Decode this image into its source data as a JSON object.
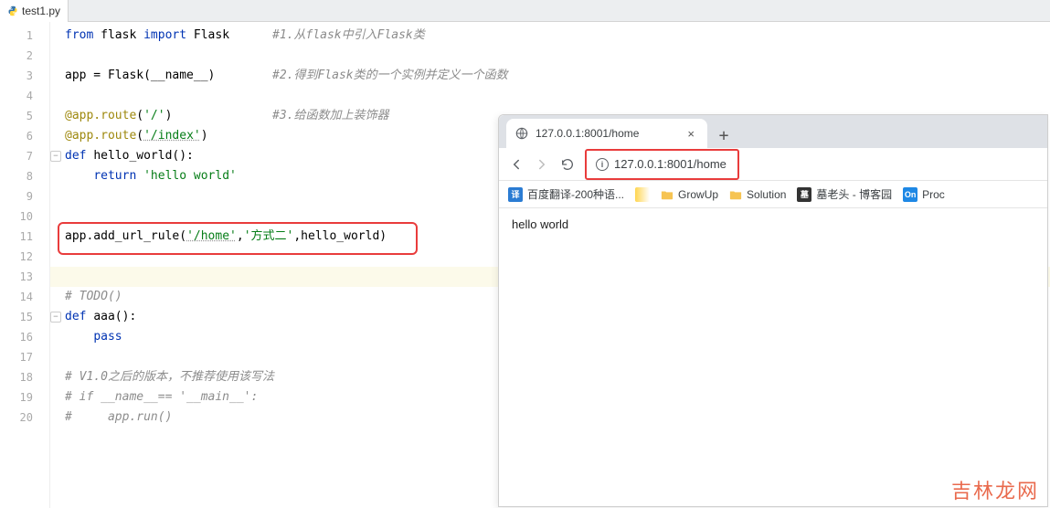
{
  "tab": {
    "filename": "test1.py"
  },
  "gutter": [
    "1",
    "2",
    "3",
    "4",
    "5",
    "6",
    "7",
    "8",
    "9",
    "10",
    "11",
    "12",
    "13",
    "14",
    "15",
    "16",
    "17",
    "18",
    "19",
    "20"
  ],
  "code": {
    "l1_kw": "from ",
    "l1_m": "flask ",
    "l1_kw2": "import ",
    "l1_cls": "Flask",
    "l1_cmt": "#1.从flask中引入Flask类",
    "l3_lhs": "app = Flask(__name__)",
    "l3_cmt": "#2.得到Flask类的一个实例并定义一个函数",
    "l5_deco": "@app.route",
    "l5_arg": "'/'",
    "l5_close": ")",
    "l5_cmt": "#3.给函数加上装饰器",
    "l6_deco": "@app.route",
    "l6_arg": "'/index'",
    "l6_close": ")",
    "l7_def": "def ",
    "l7_fn": "hello_world",
    "l7_sig": "():",
    "l8_ret": "return ",
    "l8_str": "'hello world'",
    "l11_pre": "app.add_url_rule(",
    "l11_a1": "'/home'",
    "l11_c": ",",
    "l11_a2": "'方式二'",
    "l11_c2": ",",
    "l11_a3": "hello_world",
    "l11_close": ")",
    "l14_cmt": "# TODO()",
    "l15_def": "def ",
    "l15_fn": "aaa",
    "l15_sig": "():",
    "l16_pass": "pass",
    "l18_cmt": "# V1.0之后的版本，不推荐使用该写法",
    "l19_cmt": "# if __name__== '__main__':",
    "l20_cmt": "#     app.run()"
  },
  "browser": {
    "tab_title": "127.0.0.1:8001/home",
    "url": "127.0.0.1:8001/home",
    "bookmarks": {
      "b1": "百度翻译-200种语...",
      "b2": "GrowUp",
      "b3": "Solution",
      "b4": "墓老头 - 博客园",
      "b5": "Proc"
    },
    "content": "hello world"
  },
  "watermark": "吉林龙网"
}
